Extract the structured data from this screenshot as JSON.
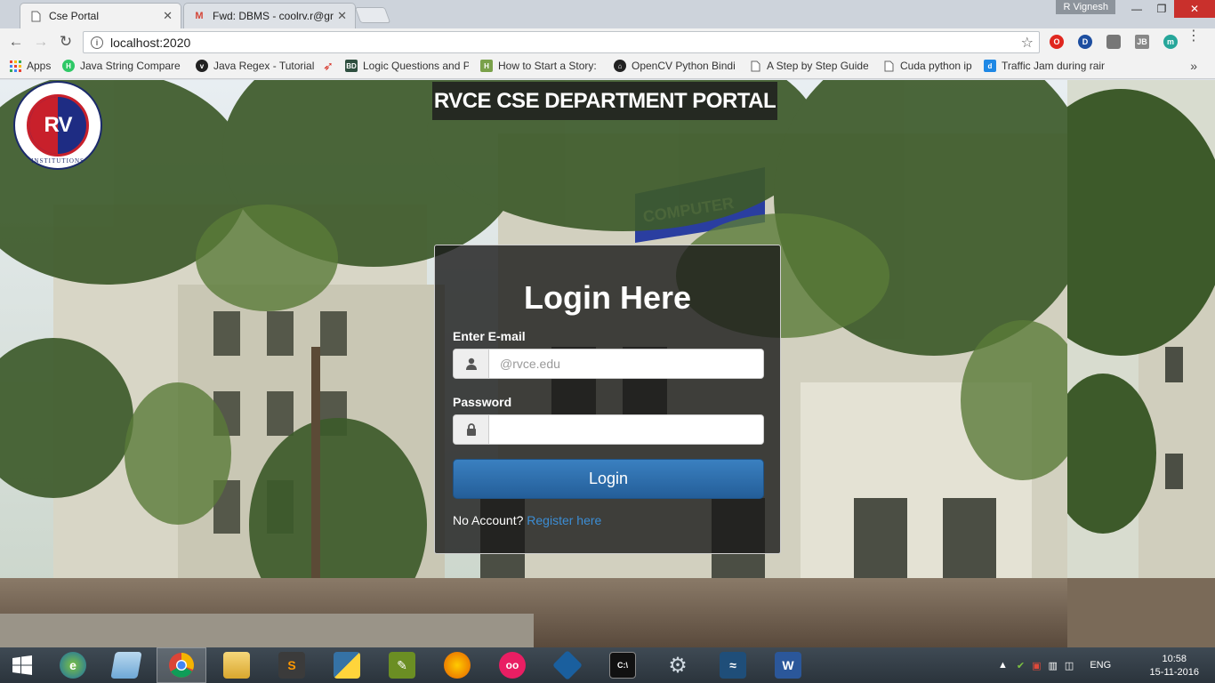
{
  "browser": {
    "tabs": [
      {
        "title": "Cse Portal",
        "active": true
      },
      {
        "title": "Fwd: DBMS - coolrv.r@gr",
        "active": false
      }
    ],
    "user": "R Vignesh",
    "url": "localhost:2020",
    "bookmarks": [
      {
        "label": "Apps",
        "icon": "apps-grid-icon"
      },
      {
        "label": "Java String Compare",
        "icon": "hackerrank-icon"
      },
      {
        "label": "Java Regex - Tutorial",
        "icon": "vogella-icon"
      },
      {
        "label": "Logic Questions and P",
        "icon": "red-curve-icon"
      },
      {
        "label": "How to Start a Story:",
        "icon": "bd-icon"
      },
      {
        "label": "OpenCV Python Bindi",
        "icon": "github-icon"
      },
      {
        "label": "A Step by Step Guide",
        "icon": "page-icon"
      },
      {
        "label": "Cuda python ip",
        "icon": "page-icon"
      },
      {
        "label": "Traffic Jam during rain",
        "icon": "d-icon"
      }
    ]
  },
  "page": {
    "portal_title": "RVCE CSE DEPARTMENT PORTAL",
    "logo_text": "RV",
    "logo_ring_text": "INSTITUTIONS",
    "login": {
      "heading": "Login Here",
      "email_label": "Enter E-mail",
      "email_placeholder": "@rvce.edu",
      "email_value": "",
      "password_label": "Password",
      "password_value": "",
      "button_label": "Login",
      "no_account_text": "No Account?",
      "register_link": "Register here"
    }
  },
  "taskbar": {
    "language": "ENG",
    "time": "10:58",
    "date": "15-11-2016"
  },
  "colors": {
    "button_blue": "#2d6ca8",
    "link_blue": "#3c8dd4",
    "panel_bg": "#191919"
  }
}
